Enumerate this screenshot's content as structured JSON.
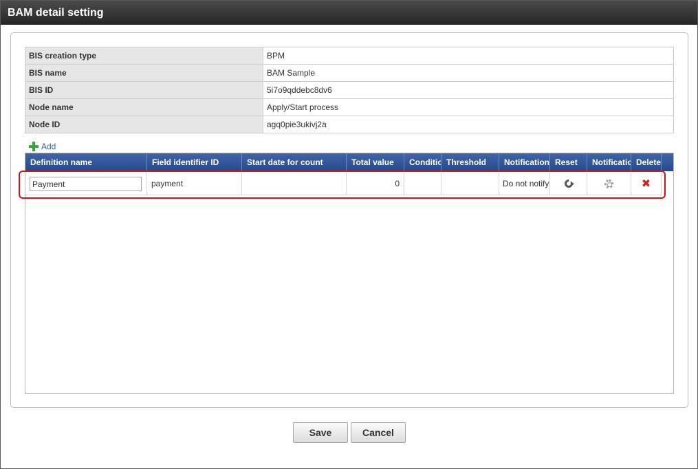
{
  "window": {
    "title": "BAM detail setting"
  },
  "info": [
    {
      "label": "BIS creation type",
      "value": "BPM"
    },
    {
      "label": "BIS name",
      "value": "BAM Sample"
    },
    {
      "label": "BIS ID",
      "value": "5i7o9qddebc8dv6"
    },
    {
      "label": "Node name",
      "value": "Apply/Start process"
    },
    {
      "label": "Node ID",
      "value": "agq0pie3ukivj2a"
    }
  ],
  "actions": {
    "add_label": "Add"
  },
  "grid": {
    "columns": [
      "Definition name",
      "Field identifier ID",
      "Start date for count",
      "Total value",
      "Condition",
      "Threshold",
      "Notification",
      "Reset",
      "Notification",
      "Delete"
    ],
    "rows": [
      {
        "definition_name": "Payment",
        "field_identifier_id": "payment",
        "start_date": "",
        "total_value": "0",
        "condition": "",
        "threshold": "",
        "notification": "Do not notify"
      }
    ]
  },
  "icons": {
    "reset": "reset-icon",
    "notification": "gear-icon",
    "delete": "delete-icon",
    "add": "plus-icon"
  },
  "colors": {
    "header": "#2f5597",
    "highlight": "#c8161d",
    "delete": "#d21e1e"
  },
  "buttons": {
    "save": "Save",
    "cancel": "Cancel"
  }
}
